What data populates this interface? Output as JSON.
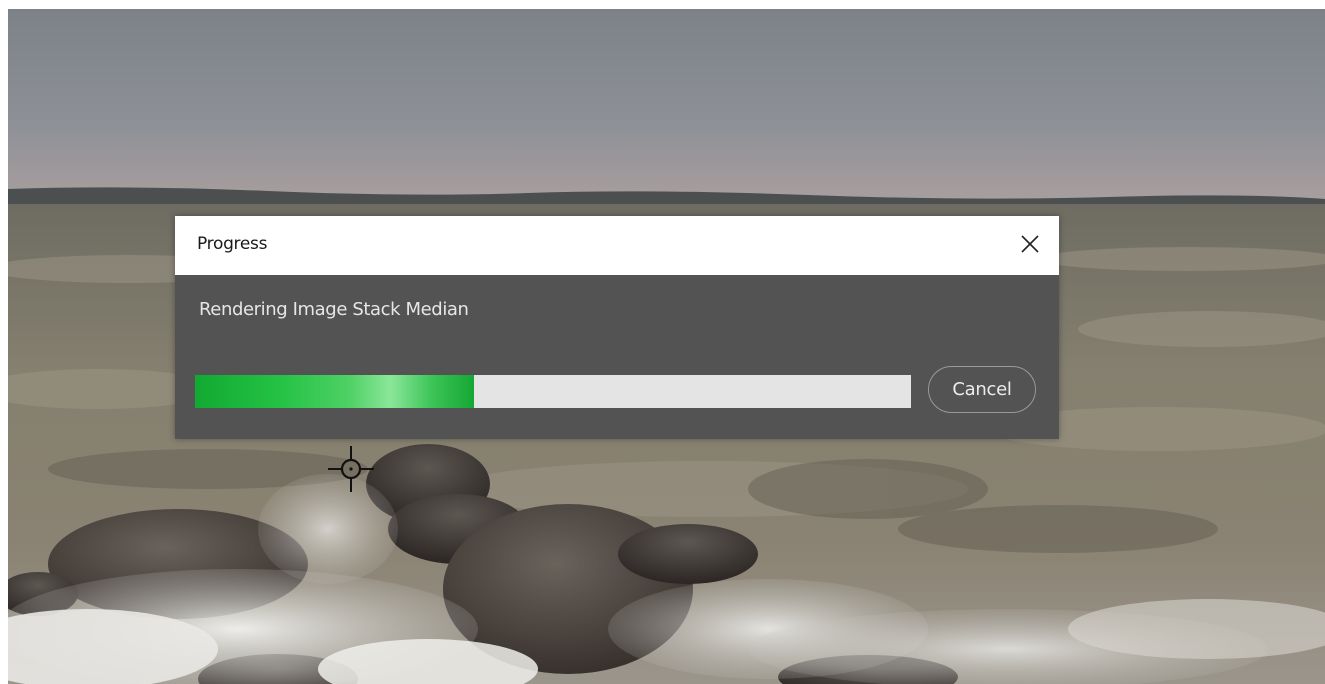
{
  "dialog": {
    "title": "Progress",
    "message": "Rendering Image Stack Median",
    "progress": 0.39,
    "cancel_label": "Cancel",
    "close_icon": "close-icon"
  },
  "canvas": {
    "cursor_icon": "crosshair-target-icon"
  },
  "colors": {
    "dialog_bg": "#535353",
    "progress_fill": "#23c244",
    "progress_track": "#e4e4e4"
  }
}
